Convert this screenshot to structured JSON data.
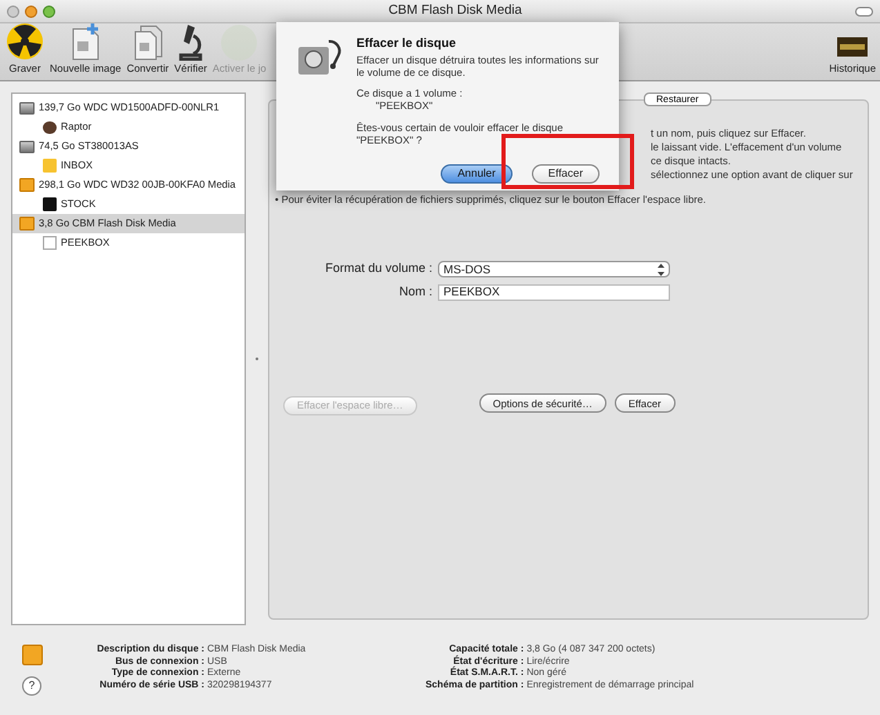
{
  "window": {
    "title": "CBM Flash Disk Media"
  },
  "toolbar": [
    {
      "label": "Graver",
      "kind": "burn",
      "disabled": false
    },
    {
      "label": "Nouvelle image",
      "kind": "new-image",
      "disabled": false
    },
    {
      "label": "Convertir",
      "kind": "convert",
      "disabled": false
    },
    {
      "label": "Vérifier",
      "kind": "verify",
      "disabled": false
    },
    {
      "label": "Activer le jo",
      "kind": "journal",
      "disabled": true
    }
  ],
  "toolbar_right": {
    "label": "Historique"
  },
  "sidebar": {
    "items": [
      {
        "label": "139,7 Go WDC WD1500ADFD-00NLR1",
        "kind": "internal",
        "selected": false,
        "children": [
          {
            "label": "Raptor",
            "kind": "dark-round",
            "selected": false
          }
        ]
      },
      {
        "label": "74,5 Go ST380013AS",
        "kind": "internal",
        "selected": false,
        "children": [
          {
            "label": "INBOX",
            "kind": "orange",
            "selected": false
          }
        ]
      },
      {
        "label": "298,1 Go WDC WD32 00JB-00KFA0 Media",
        "kind": "external",
        "selected": false,
        "children": [
          {
            "label": "STOCK",
            "kind": "black",
            "selected": false
          }
        ]
      },
      {
        "label": "3,8 Go CBM Flash Disk Media",
        "kind": "external",
        "selected": true,
        "children": [
          {
            "label": "PEEKBOX",
            "kind": "white",
            "selected": false
          }
        ]
      }
    ]
  },
  "tabs": [
    {
      "label": "Restaurer",
      "selected": false
    }
  ],
  "panel": {
    "lines": [
      "t un nom, puis cliquez sur Effacer.",
      "le laissant vide. L'effacement d'un volume",
      "ce disque intacts.",
      "sélectionnez une option avant de cliquer sur"
    ],
    "last_line": "• Pour éviter la récupération de fichiers supprimés, cliquez sur le bouton Effacer l'espace libre.",
    "format_label": "Format du volume :",
    "format_value": "MS-DOS",
    "name_label": "Nom :",
    "name_value": "PEEKBOX",
    "buttons": [
      {
        "label": "Effacer l'espace libre…",
        "disabled": true
      },
      {
        "label": "Options de sécurité…",
        "disabled": false
      },
      {
        "label": "Effacer",
        "disabled": false
      }
    ]
  },
  "dialog": {
    "title": "Effacer le disque",
    "text": "Effacer un disque détruira toutes les informations sur le volume de ce disque.",
    "volumes_text": "Ce disque a 1 volume :",
    "volume": "\"PEEKBOX\"",
    "question": "Êtes-vous certain de vouloir effacer le disque \"PEEKBOX\" ?",
    "buttons": [
      {
        "label": "Annuler",
        "default": true
      },
      {
        "label": "Effacer",
        "default": false
      }
    ]
  },
  "info": {
    "left": [
      {
        "label": "Description du disque :",
        "value": "CBM Flash Disk Media"
      },
      {
        "label": "Bus de connexion :",
        "value": "USB"
      },
      {
        "label": "Type de connexion :",
        "value": "Externe"
      },
      {
        "label": "Numéro de série USB :",
        "value": "320298194377"
      }
    ],
    "right": [
      {
        "label": "Capacité totale :",
        "value": "3,8 Go (4 087 347 200 octets)"
      },
      {
        "label": "État d'écriture :",
        "value": "Lire/écrire"
      },
      {
        "label": "État S.M.A.R.T. :",
        "value": "Non géré"
      },
      {
        "label": "Schéma de partition :",
        "value": "Enregistrement de démarrage principal"
      }
    ],
    "help": "?"
  }
}
